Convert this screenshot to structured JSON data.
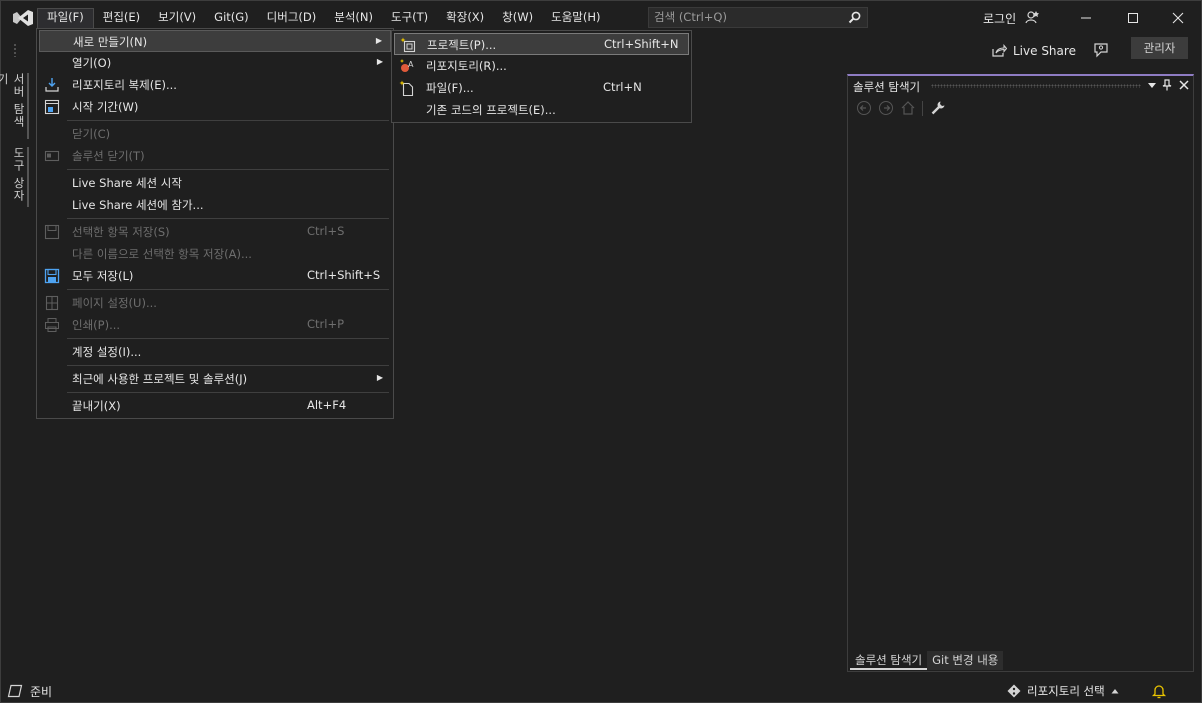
{
  "menubar": {
    "items": [
      "파일(F)",
      "편집(E)",
      "보기(V)",
      "Git(G)",
      "디버그(D)",
      "분석(N)",
      "도구(T)",
      "확장(X)",
      "창(W)",
      "도움말(H)"
    ],
    "search_placeholder": "검색 (Ctrl+Q)"
  },
  "titlebar": {
    "login": "로그인"
  },
  "toolbar": {
    "live_share": "Live Share",
    "admin": "관리자"
  },
  "side_tabs": {
    "server_explorer": "서버 탐색기",
    "toolbox": "도구 상자"
  },
  "file_menu": {
    "new": "새로 만들기(N)",
    "open": "열기(O)",
    "clone": "리포지토리 복제(E)...",
    "start_window": "시작 기간(W)",
    "close": "닫기(C)",
    "close_solution": "솔루션 닫기(T)",
    "live_share_start": "Live Share 세션 시작",
    "live_share_join": "Live Share 세션에 참가...",
    "save_selected": "선택한 항목 저장(S)",
    "save_selected_sc": "Ctrl+S",
    "save_as": "다른 이름으로 선택한 항목 저장(A)...",
    "save_all": "모두 저장(L)",
    "save_all_sc": "Ctrl+Shift+S",
    "page_setup": "페이지 설정(U)...",
    "print": "인쇄(P)...",
    "print_sc": "Ctrl+P",
    "account_settings": "계정 설정(I)...",
    "recent": "최근에 사용한 프로젝트 및 솔루션(J)",
    "exit": "끝내기(X)",
    "exit_sc": "Alt+F4"
  },
  "new_submenu": {
    "project": "프로젝트(P)...",
    "project_sc": "Ctrl+Shift+N",
    "repository": "리포지토리(R)...",
    "file": "파일(F)...",
    "file_sc": "Ctrl+N",
    "from_existing": "기존 코드의 프로젝트(E)..."
  },
  "solution_explorer": {
    "title": "솔루션 탐색기",
    "tabs": [
      "솔루션 탐색기",
      "Git 변경 내용"
    ]
  },
  "statusbar": {
    "ready": "준비",
    "repo_select": "리포지토리 선택"
  },
  "colors": {
    "accent": "#8e7cc3",
    "save_icon": "#4ea3f1",
    "bell": "#e8c300"
  }
}
